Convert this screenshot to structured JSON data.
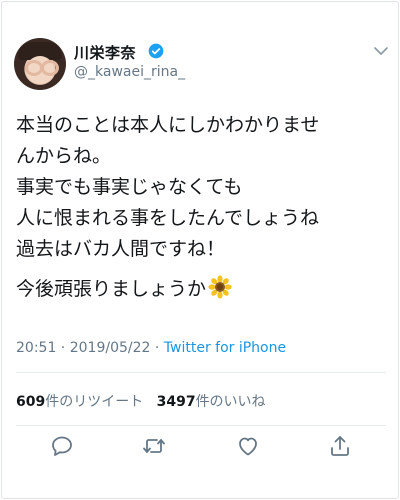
{
  "user": {
    "display_name": "川栄李奈",
    "handle": "@_kawaei_rina_",
    "verified": true
  },
  "tweet": {
    "lines": [
      "本当のことは本人にしかわかりませ",
      "んからね。",
      "事実でも事実じゃなくても",
      "人に恨まれる事をしたんでしょうね",
      "過去はバカ人間ですね！"
    ],
    "last_line": "今後頑張りましょうか",
    "emoji": "sunflower-icon"
  },
  "meta": {
    "time": "20:51",
    "separator1": " · ",
    "date": "2019/05/22",
    "separator2": " · ",
    "source": "Twitter for iPhone"
  },
  "stats": {
    "retweet_count": "609",
    "retweet_label": "件のリツイート",
    "like_count": "3497",
    "like_label": "件のいいね"
  },
  "colors": {
    "text": "#14171a",
    "muted": "#657786",
    "link": "#1b95e0",
    "verified": "#1da1f2",
    "divider": "#e6ecf0"
  },
  "actions": [
    "reply-icon",
    "retweet-icon",
    "like-icon",
    "share-icon"
  ]
}
